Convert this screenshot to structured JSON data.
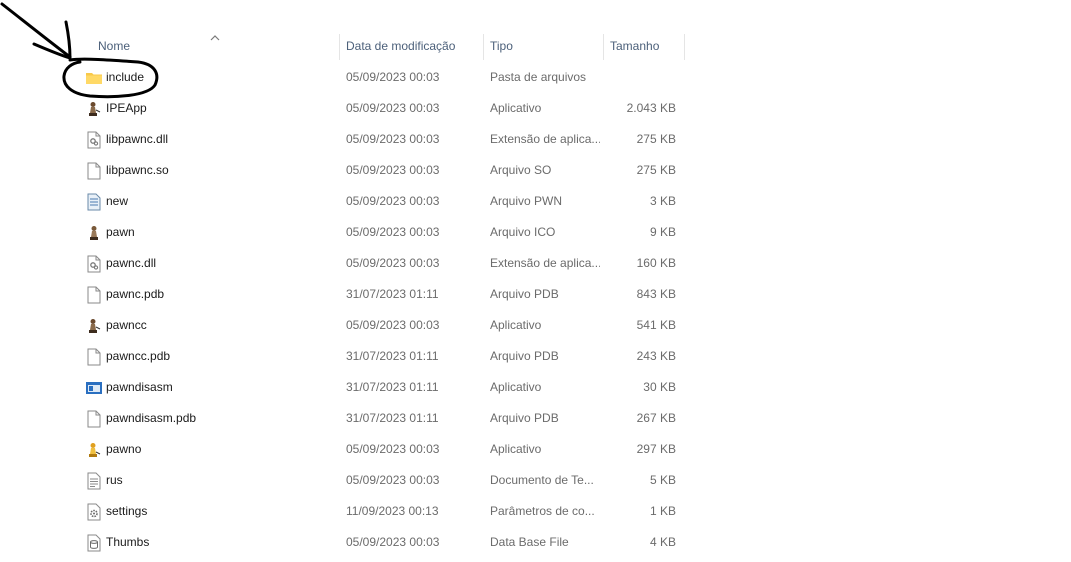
{
  "columns": {
    "name": "Nome",
    "date": "Data de modificação",
    "type": "Tipo",
    "size": "Tamanho"
  },
  "files": [
    {
      "name": "include",
      "date": "05/09/2023 00:03",
      "type": "Pasta de arquivos",
      "size": "",
      "icon": "folder-icon"
    },
    {
      "name": "IPEApp",
      "date": "05/09/2023 00:03",
      "type": "Aplicativo",
      "size": "2.043 KB",
      "icon": "pawn-app-icon"
    },
    {
      "name": "libpawnc.dll",
      "date": "05/09/2023 00:03",
      "type": "Extensão de aplica...",
      "size": "275 KB",
      "icon": "dll-file-icon"
    },
    {
      "name": "libpawnc.so",
      "date": "05/09/2023 00:03",
      "type": "Arquivo SO",
      "size": "275 KB",
      "icon": "blank-file-icon"
    },
    {
      "name": "new",
      "date": "05/09/2023 00:03",
      "type": "Arquivo PWN",
      "size": "3 KB",
      "icon": "pwn-file-icon"
    },
    {
      "name": "pawn",
      "date": "05/09/2023 00:03",
      "type": "Arquivo ICO",
      "size": "9 KB",
      "icon": "pawn-image-icon"
    },
    {
      "name": "pawnc.dll",
      "date": "05/09/2023 00:03",
      "type": "Extensão de aplica...",
      "size": "160 KB",
      "icon": "dll-file-icon"
    },
    {
      "name": "pawnc.pdb",
      "date": "31/07/2023 01:11",
      "type": "Arquivo PDB",
      "size": "843 KB",
      "icon": "blank-file-icon"
    },
    {
      "name": "pawncc",
      "date": "05/09/2023 00:03",
      "type": "Aplicativo",
      "size": "541 KB",
      "icon": "pawn-app-icon"
    },
    {
      "name": "pawncc.pdb",
      "date": "31/07/2023 01:11",
      "type": "Arquivo PDB",
      "size": "243 KB",
      "icon": "blank-file-icon"
    },
    {
      "name": "pawndisasm",
      "date": "31/07/2023 01:11",
      "type": "Aplicativo",
      "size": "30 KB",
      "icon": "window-app-icon"
    },
    {
      "name": "pawndisasm.pdb",
      "date": "31/07/2023 01:11",
      "type": "Arquivo PDB",
      "size": "267 KB",
      "icon": "blank-file-icon"
    },
    {
      "name": "pawno",
      "date": "05/09/2023 00:03",
      "type": "Aplicativo",
      "size": "297 KB",
      "icon": "pawno-app-icon"
    },
    {
      "name": "rus",
      "date": "05/09/2023 00:03",
      "type": "Documento de Te...",
      "size": "5 KB",
      "icon": "text-file-icon"
    },
    {
      "name": "settings",
      "date": "11/09/2023 00:13",
      "type": "Parâmetros de co...",
      "size": "1 KB",
      "icon": "settings-file-icon"
    },
    {
      "name": "Thumbs",
      "date": "05/09/2023 00:03",
      "type": "Data Base File",
      "size": "4 KB",
      "icon": "database-file-icon"
    }
  ]
}
